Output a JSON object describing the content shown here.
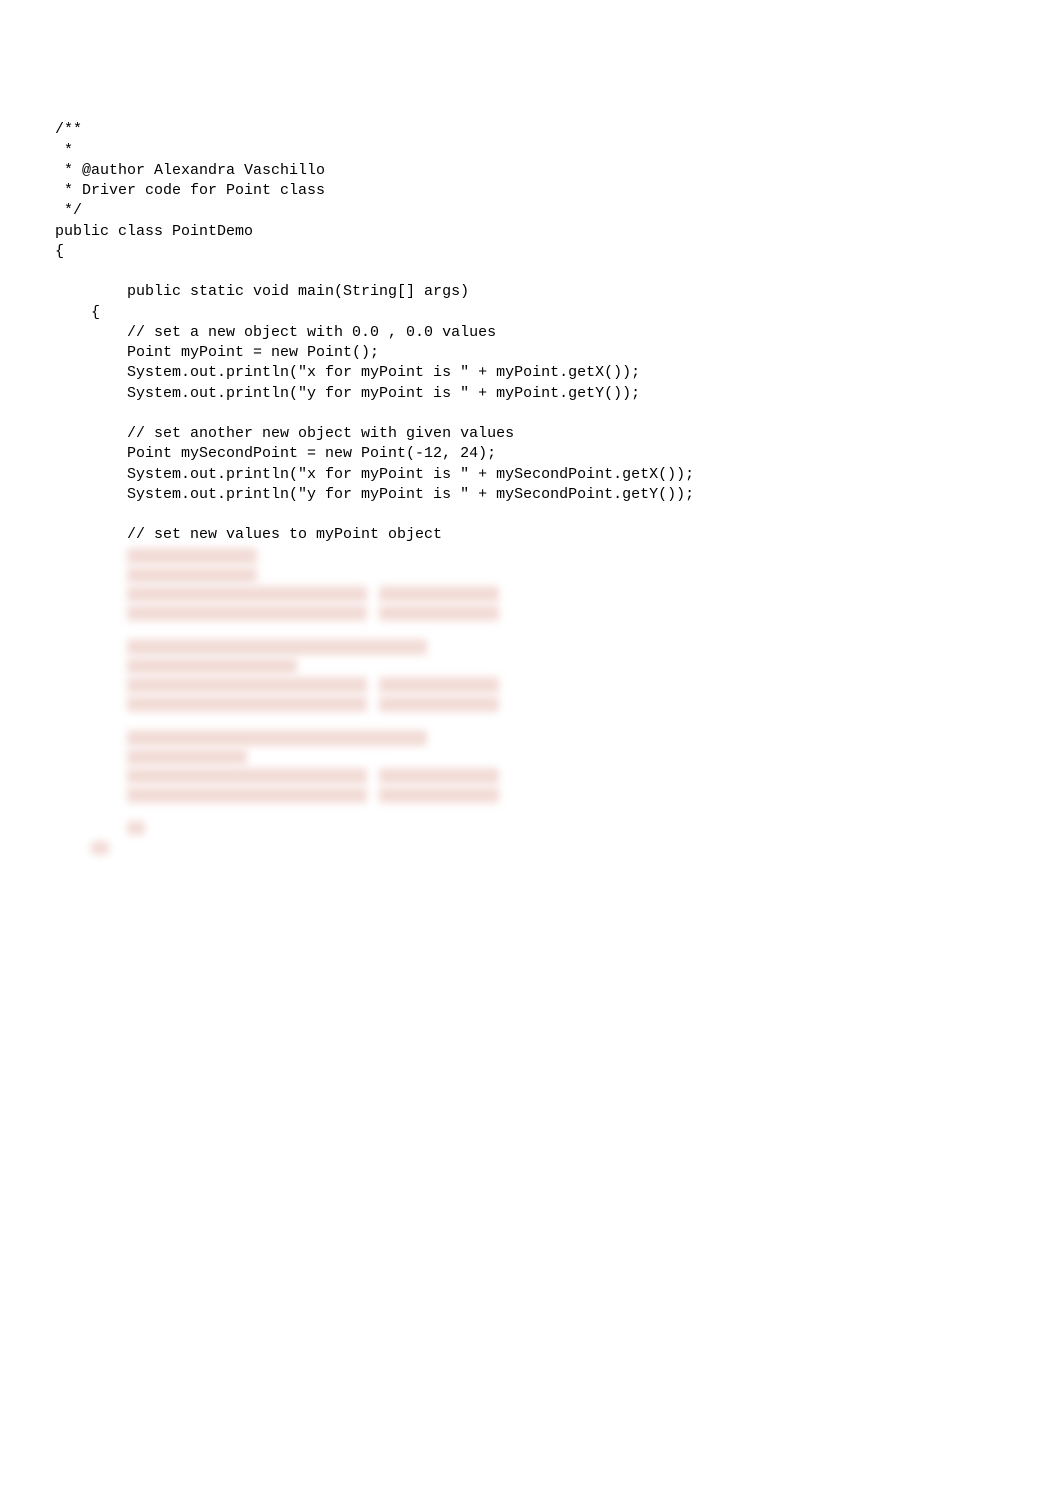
{
  "code": {
    "lines": [
      "/**",
      " *",
      " * @author Alexandra Vaschillo",
      " * Driver code for Point class",
      " */",
      "public class PointDemo",
      "{",
      "",
      "        public static void main(String[] args)",
      "    {",
      "        // set a new object with 0.0 , 0.0 values",
      "        Point myPoint = new Point();",
      "        System.out.println(\"x for myPoint is \" + myPoint.getX());",
      "        System.out.println(\"y for myPoint is \" + myPoint.getY());",
      "",
      "        // set another new object with given values",
      "        Point mySecondPoint = new Point(-12, 24);",
      "        System.out.println(\"x for myPoint is \" + mySecondPoint.getX());",
      "        System.out.println(\"y for myPoint is \" + mySecondPoint.getY());",
      "",
      "        // set new values to myPoint object"
    ]
  }
}
